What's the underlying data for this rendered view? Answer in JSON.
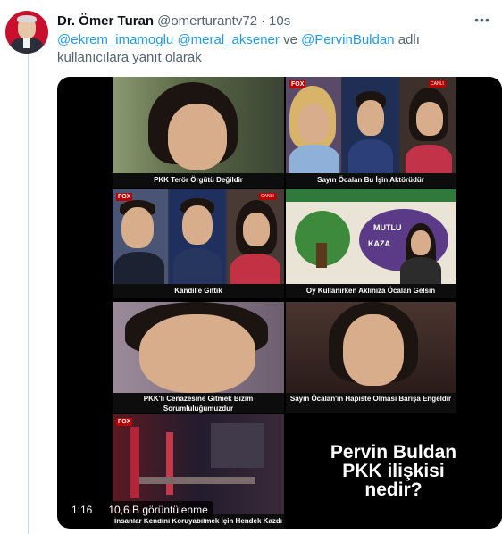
{
  "tweet": {
    "author_name": "Dr. Ömer Turan",
    "author_handle": "@omerturantv72",
    "separator": "·",
    "time": "10s",
    "more_icon": "ellipsis-icon"
  },
  "reply": {
    "mentions": [
      "@ekrem_imamoglu",
      "@meral_aksener",
      "@PervinBuldan"
    ],
    "connector": "ve",
    "suffix": "adlı kullanıcılara yanıt olarak"
  },
  "video": {
    "duration": "1:16",
    "views": "10,6 B görüntülenme",
    "panels": [
      {
        "caption": "PKK Terör Örgütü Değildir"
      },
      {
        "caption": "Sayın Öcalan Bu İşin Aktörüdür",
        "channel_logo": "FOX",
        "live_badge": "CANLI"
      },
      {
        "caption": "Kandil'e Gittik",
        "channel_logo": "FOX",
        "live_badge": "CANLI"
      },
      {
        "caption": "Oy Kullanırken Aklınıza Öcalan Gelsin",
        "banner_text_1": "MUTLU",
        "banner_text_2": "KAZA"
      },
      {
        "caption": "PKK'lı Cenazesine Gitmek Bizim Sorumluluğumuzdur"
      },
      {
        "caption": "Sayın Öcalan'ın Hapiste Olması Barışa Engeldir"
      },
      {
        "caption": "İnsanlar Kendini Koruyabilmek İçin Hendek Kazdı",
        "channel_logo": "FOX"
      }
    ],
    "title_card": {
      "line1": "Pervin Buldan",
      "line2": "PKK ilişkisi",
      "line3": "nedir?"
    }
  },
  "colors": {
    "link": "#1d9bf0",
    "secondary_text": "#536471",
    "primary_text": "#0f1419",
    "avatar_bg": "#c8102e"
  }
}
